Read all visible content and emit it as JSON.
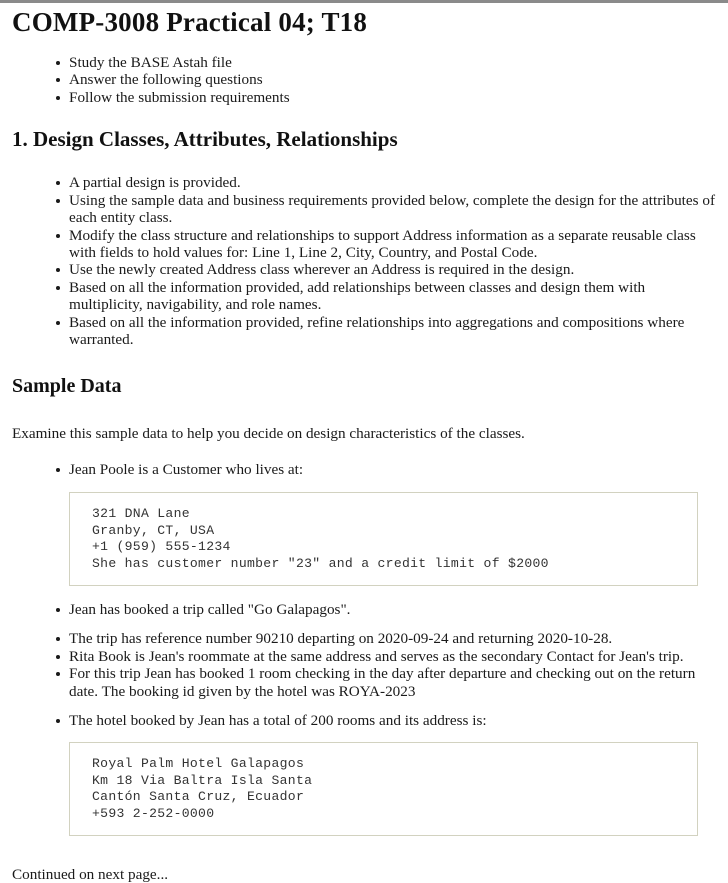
{
  "document": {
    "title": "COMP-3008 Practical 04; T18",
    "intro_list": [
      "Study the BASE Astah file",
      "Answer the following questions",
      "Follow the submission requirements"
    ],
    "section1": {
      "heading": "1. Design Classes, Attributes, Relationships",
      "items": [
        "A partial design is provided.",
        "Using the sample data and business requirements provided below, complete the design for the attributes of each entity class.",
        "Modify the class structure and relationships to support Address information as a separate reusable class with fields to hold values for: Line 1, Line 2, City, Country, and Postal Code.",
        "Use the newly created Address class wherever an Address is required in the design.",
        "Based on all the information provided, add relationships between classes and design them with multiplicity, navigability, and role names.",
        "Based on all the information provided, refine relationships into aggregations and compositions where warranted."
      ]
    },
    "sample_data": {
      "heading": "Sample Data",
      "intro": "Examine this sample data to help you decide on design characteristics of the classes.",
      "customer_bullet": "Jean Poole is a Customer who lives at:",
      "customer_block": "321 DNA Lane\nGranby, CT, USA\n+1 (959) 555-1234\nShe has customer number \"23\" and a credit limit of $2000",
      "trip_bullet": "Jean has booked a trip called \"Go Galapagos\".",
      "detail_items": [
        "The trip has reference number 90210 departing on 2020-09-24 and returning 2020-10-28.",
        "Rita Book is Jean's roommate at the same address and serves as the secondary Contact for Jean's trip.",
        "For this trip Jean has booked 1 room checking in the day after departure and checking out on the return date. The booking id given by the hotel was ROYA-2023"
      ],
      "hotel_bullet": "The hotel booked by Jean has a total of 200 rooms and its address is:",
      "hotel_block": "Royal Palm Hotel Galapagos\nKm 18 Via Baltra Isla Santa\nCantón Santa Cruz, Ecuador\n+593 2-252-0000"
    },
    "footer": "Continued on next page..."
  },
  "colors": {
    "text": "#1a1a1a",
    "heading": "#111111",
    "code_border": "#d2d2c0",
    "code_text": "#333333",
    "top_rule": "#8a8a8a"
  }
}
